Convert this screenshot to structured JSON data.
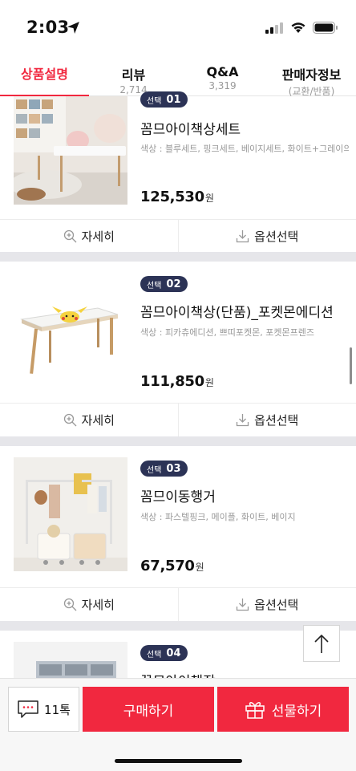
{
  "status_bar": {
    "time": "2:03"
  },
  "tabs": [
    {
      "label": "상품설명",
      "sub": ""
    },
    {
      "label": "리뷰",
      "sub": "2,714"
    },
    {
      "label": "Q&A",
      "sub": "3,319"
    },
    {
      "label": "판매자정보",
      "sub": "(교환/반품)"
    }
  ],
  "products": [
    {
      "badge_label": "선택",
      "badge_num": "01",
      "name": "꼼므아이책상세트",
      "colors": "색상 : 블루세트, 핑크세트, 베이지세트, 화이트+그레이의",
      "price": "125,530",
      "currency": "원"
    },
    {
      "badge_label": "선택",
      "badge_num": "02",
      "name": "꼼므아이책상(단품)_포켓몬에디션",
      "colors": "색상 : 피카츄에디션, 쁘띠포켓몬, 포켓몬프렌즈",
      "price": "111,850",
      "currency": "원"
    },
    {
      "badge_label": "선택",
      "badge_num": "03",
      "name": "꼼므이동행거",
      "colors": "색상 : 파스텔핑크, 메이플, 화이트, 베이지",
      "price": "67,570",
      "currency": "원"
    },
    {
      "badge_label": "선택",
      "badge_num": "04",
      "name": "꼼므아이책장"
    }
  ],
  "actions": {
    "detail": "자세히",
    "option": "옵션선택"
  },
  "bottom": {
    "talk": "11톡",
    "buy": "구매하기",
    "gift": "선물하기"
  },
  "colors": {
    "accent": "#f1283f",
    "badge": "#2c3356"
  }
}
